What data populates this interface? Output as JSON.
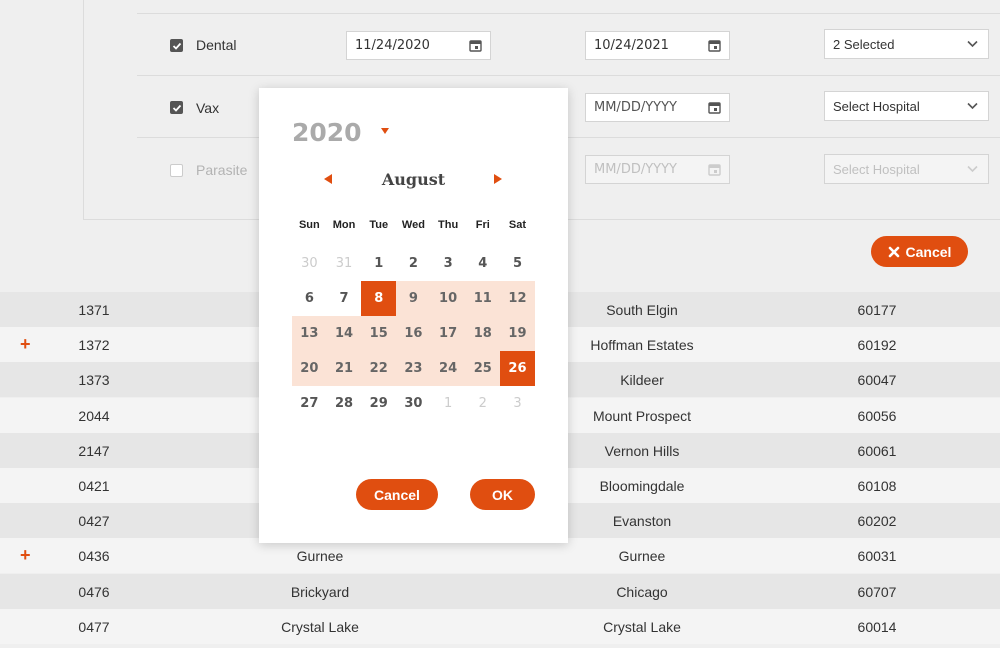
{
  "filters": [
    {
      "checked": true,
      "label": "Dental",
      "start": "11/24/2020",
      "end": "10/24/2021",
      "select": "2 Selected",
      "disabled": false
    },
    {
      "checked": true,
      "label": "Vax",
      "start": "",
      "end": "MM/DD/YYYY",
      "select": "Select Hospital",
      "disabled": false
    },
    {
      "checked": false,
      "label": "Parasite",
      "start": "",
      "end": "MM/DD/YYYY",
      "select": "Select Hospital",
      "disabled": true
    }
  ],
  "cancel_label": "Cancel",
  "picker": {
    "year": "2020",
    "month": "August",
    "weekdays": [
      "Sun",
      "Mon",
      "Tue",
      "Wed",
      "Thu",
      "Fri",
      "Sat"
    ],
    "weeks": [
      [
        "30",
        "31",
        "1",
        "2",
        "3",
        "4",
        "5"
      ],
      [
        "6",
        "7",
        "8",
        "9",
        "10",
        "11",
        "12"
      ],
      [
        "13",
        "14",
        "15",
        "16",
        "17",
        "18",
        "19"
      ],
      [
        "20",
        "21",
        "22",
        "23",
        "24",
        "25",
        "26"
      ],
      [
        "27",
        "28",
        "29",
        "30",
        "1",
        "2",
        "3"
      ]
    ],
    "cancel_label": "Cancel",
    "ok_label": "OK",
    "colors": {
      "accent": "#e04e10",
      "range": "#fbe3d6"
    }
  },
  "table": [
    {
      "id": "1371",
      "name": "",
      "city": "South Elgin",
      "zip": "60177",
      "plus": false
    },
    {
      "id": "1372",
      "name": "",
      "city": "Hoffman Estates",
      "zip": "60192",
      "plus": true
    },
    {
      "id": "1373",
      "name": "",
      "city": "Kildeer",
      "zip": "60047",
      "plus": false
    },
    {
      "id": "2044",
      "name": "",
      "city": "Mount Prospect",
      "zip": "60056",
      "plus": false
    },
    {
      "id": "2147",
      "name": "",
      "city": "Vernon Hills",
      "zip": "60061",
      "plus": false
    },
    {
      "id": "0421",
      "name": "",
      "city": "Bloomingdale",
      "zip": "60108",
      "plus": false
    },
    {
      "id": "0427",
      "name": "",
      "city": "Evanston",
      "zip": "60202",
      "plus": false
    },
    {
      "id": "0436",
      "name": "Gurnee",
      "city": "Gurnee",
      "zip": "60031",
      "plus": true
    },
    {
      "id": "0476",
      "name": "Brickyard",
      "city": "Chicago",
      "zip": "60707",
      "plus": false
    },
    {
      "id": "0477",
      "name": "Crystal Lake",
      "city": "Crystal Lake",
      "zip": "60014",
      "plus": false
    }
  ],
  "plus_symbol": "+"
}
